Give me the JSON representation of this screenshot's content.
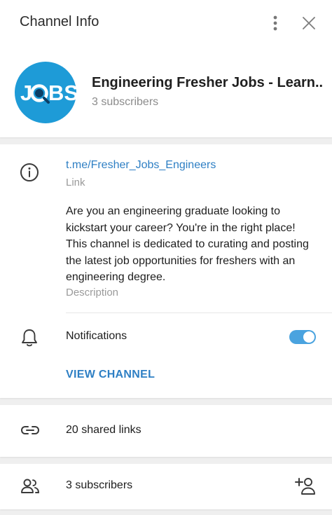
{
  "header": {
    "title": "Channel Info"
  },
  "channel": {
    "avatar_text": "JOBS",
    "name": "Engineering Fresher Jobs - Learn...",
    "subscribers": "3 subscribers"
  },
  "info": {
    "link": "t.me/Fresher_Jobs_Engineers",
    "link_label": "Link",
    "description": "Are you an engineering graduate looking to kickstart your career? You're in the right place! This channel is dedicated to curating and posting the latest job opportunities for freshers with an engineering degree.",
    "description_label": "Description",
    "notifications_label": "Notifications",
    "notifications_on": true,
    "view_channel_label": "VIEW CHANNEL"
  },
  "shared": {
    "links_label": "20 shared links"
  },
  "members": {
    "label": "3 subscribers"
  },
  "colors": {
    "accent": "#2e7fc4",
    "toggle": "#4aa3df",
    "avatar_bg": "#1e9bd7"
  }
}
